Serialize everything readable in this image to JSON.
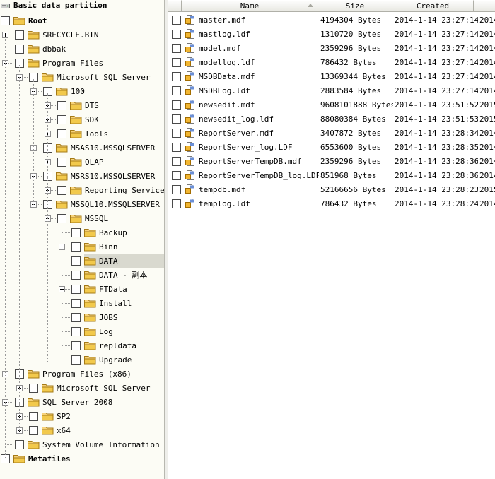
{
  "tree": {
    "header": "Basic data partition",
    "nodes": [
      {
        "label": "Root",
        "bold": true
      },
      {
        "label": "$RECYCLE.BIN"
      },
      {
        "label": "dbbak"
      },
      {
        "label": "Program Files"
      },
      {
        "label": "Microsoft SQL Server"
      },
      {
        "label": "100"
      },
      {
        "label": "DTS"
      },
      {
        "label": "SDK"
      },
      {
        "label": "Tools"
      },
      {
        "label": "MSAS10.MSSQLSERVER"
      },
      {
        "label": "OLAP"
      },
      {
        "label": "MSRS10.MSSQLSERVER"
      },
      {
        "label": "Reporting Services"
      },
      {
        "label": "MSSQL10.MSSQLSERVER"
      },
      {
        "label": "MSSQL"
      },
      {
        "label": "Backup"
      },
      {
        "label": "Binn"
      },
      {
        "label": "DATA",
        "selected": true
      },
      {
        "label": "DATA - 副本"
      },
      {
        "label": "FTData"
      },
      {
        "label": "Install"
      },
      {
        "label": "JOBS"
      },
      {
        "label": "Log"
      },
      {
        "label": "repldata"
      },
      {
        "label": "Upgrade"
      },
      {
        "label": "Program Files (x86)"
      },
      {
        "label": "Microsoft SQL Server"
      },
      {
        "label": "SQL Server 2008"
      },
      {
        "label": "SP2"
      },
      {
        "label": "x64"
      },
      {
        "label": "System Volume Information"
      },
      {
        "label": "Metafiles",
        "bold": true
      }
    ]
  },
  "list": {
    "columns": {
      "name": "Name",
      "size": "Size",
      "created": "Created"
    },
    "files": [
      {
        "name": "master.mdf",
        "size": "4194304 Bytes",
        "created": "2014-1-14 23:27:14",
        "modified": "2014-"
      },
      {
        "name": "mastlog.ldf",
        "size": "1310720 Bytes",
        "created": "2014-1-14 23:27:14",
        "modified": "2014-"
      },
      {
        "name": "model.mdf",
        "size": "2359296 Bytes",
        "created": "2014-1-14 23:27:14",
        "modified": "2014-"
      },
      {
        "name": "modellog.ldf",
        "size": "786432 Bytes",
        "created": "2014-1-14 23:27:14",
        "modified": "2014-"
      },
      {
        "name": "MSDBData.mdf",
        "size": "13369344 Bytes",
        "created": "2014-1-14 23:27:14",
        "modified": "2014-"
      },
      {
        "name": "MSDBLog.ldf",
        "size": "2883584 Bytes",
        "created": "2014-1-14 23:27:14",
        "modified": "2014-"
      },
      {
        "name": "newsedit.mdf",
        "size": "9608101888 Bytes",
        "created": "2014-1-14 23:51:52",
        "modified": "2015-"
      },
      {
        "name": "newsedit_log.ldf",
        "size": "88080384 Bytes",
        "created": "2014-1-14 23:51:53",
        "modified": "2015-"
      },
      {
        "name": "ReportServer.mdf",
        "size": "3407872 Bytes",
        "created": "2014-1-14 23:28:34",
        "modified": "2014-"
      },
      {
        "name": "ReportServer_log.LDF",
        "size": "6553600 Bytes",
        "created": "2014-1-14 23:28:35",
        "modified": "2014-"
      },
      {
        "name": "ReportServerTempDB.mdf",
        "size": "2359296 Bytes",
        "created": "2014-1-14 23:28:36",
        "modified": "2014-"
      },
      {
        "name": "ReportServerTempDB_log.LDF",
        "size": "851968 Bytes",
        "created": "2014-1-14 23:28:36",
        "modified": "2014-"
      },
      {
        "name": "tempdb.mdf",
        "size": "52166656 Bytes",
        "created": "2014-1-14 23:28:23",
        "modified": "2015-"
      },
      {
        "name": "templog.ldf",
        "size": "786432 Bytes",
        "created": "2014-1-14 23:28:24",
        "modified": "2014-"
      }
    ]
  },
  "colors": {
    "selection": "#d9d9cf",
    "folder": "#f2c94c",
    "tree_bg": "#fcfcf5"
  }
}
